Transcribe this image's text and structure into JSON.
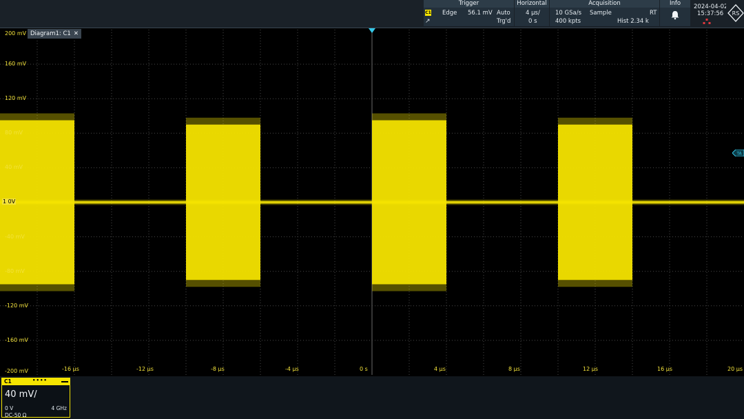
{
  "trigger": {
    "title": "Trigger",
    "channel": "C1",
    "type": "Edge",
    "level": "56.1 mV",
    "mode": "Auto",
    "state": "Trg'd"
  },
  "horizontal": {
    "title": "Horizontal",
    "scale": "4 µs/",
    "position": "0 s"
  },
  "acquisition": {
    "title": "Acquisition",
    "sample_rate": "10 GSa/s",
    "mode": "Sample",
    "rt": "RT",
    "record_length": "400 kpts",
    "history": "Hist 2.34 k"
  },
  "info": {
    "title": "Info",
    "icon": "bell-icon"
  },
  "datetime": {
    "date": "2024-04-02",
    "time": "15:37:56"
  },
  "logo": {
    "text": "RS",
    "icon": "rohde-schwarz-logo"
  },
  "diagram": {
    "tab_label": "Diagram1: C1",
    "trace_color": "#f5e400",
    "zero_marker": "1 0V",
    "trigger_level_marker": "TA",
    "y_ticks": [
      "200 mV",
      "160 mV",
      "120 mV",
      "80 mV",
      "40 mV",
      "0 V",
      "-40 mV",
      "-80 mV",
      "-120 mV",
      "-160 mV",
      "-200 mV"
    ],
    "x_ticks": [
      "-16 µs",
      "-12 µs",
      "-8 µs",
      "-4 µs",
      "0 s",
      "4 µs",
      "8 µs",
      "12 µs",
      "16 µs",
      "20 µs"
    ]
  },
  "chart_data": {
    "type": "line",
    "x_unit": "µs",
    "y_unit": "mV",
    "xlim": [
      -20,
      20
    ],
    "ylim": [
      -200,
      200
    ],
    "grid": true,
    "series": [
      {
        "color": "#f5e400",
        "bursts": [
          {
            "start": -20.0,
            "end": -16.0,
            "amplitude": 95
          },
          {
            "start": -10.0,
            "end": -6.0,
            "amplitude": 90
          },
          {
            "start": 0.0,
            "end": 4.0,
            "amplitude": 95
          },
          {
            "start": 10.0,
            "end": 14.0,
            "amplitude": 90
          }
        ],
        "baseline": 0
      }
    ]
  },
  "channel": {
    "name": "C1",
    "scale": "40 mV/",
    "offset": "0 V",
    "bandwidth": "4 GHz",
    "coupling": "DC-50 Ω"
  }
}
